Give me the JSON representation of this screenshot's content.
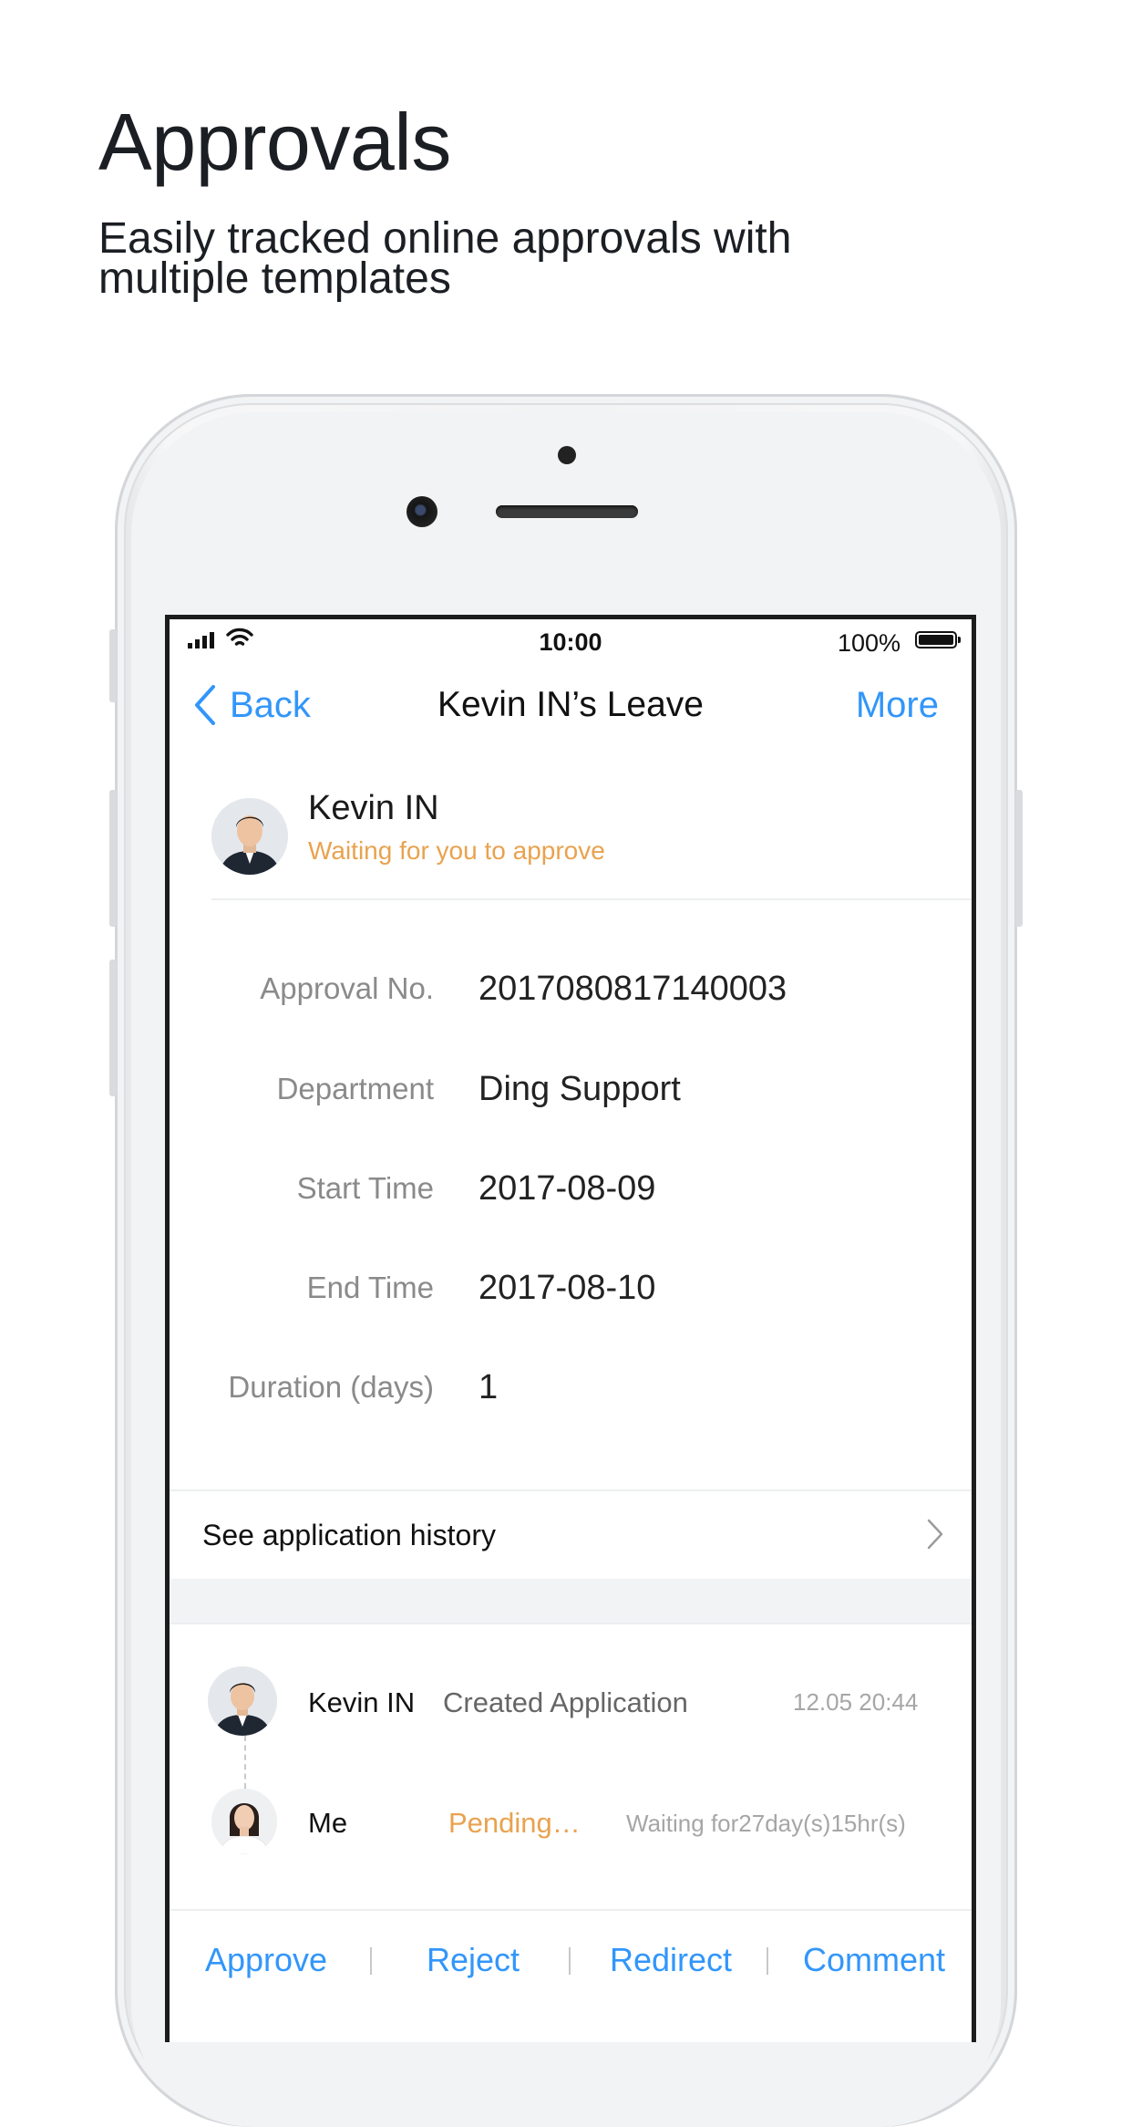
{
  "marketing": {
    "headline": "Approvals",
    "subline": "Easily tracked online approvals with multiple templates"
  },
  "status_bar": {
    "time": "10:00",
    "battery": "100%"
  },
  "nav": {
    "back_label": "Back",
    "title": "Kevin IN’s Leave",
    "more_label": "More"
  },
  "applicant": {
    "name": "Kevin IN",
    "status": "Waiting for you to approve"
  },
  "details": [
    {
      "label": "Approval No.",
      "value": "2017080817140003"
    },
    {
      "label": "Department",
      "value": "Ding Support"
    },
    {
      "label": "Start Time",
      "value": "2017-08-09"
    },
    {
      "label": "End Time",
      "value": "2017-08-10"
    },
    {
      "label": "Duration (days)",
      "value": "1"
    }
  ],
  "history_link": "See application history",
  "flow": [
    {
      "name": "Kevin IN",
      "action": "Created Application",
      "time": "12.05 20:44"
    },
    {
      "name": "Me",
      "action": "Pending…",
      "time": "Waiting for27day(s)15hr(s)"
    }
  ],
  "actions": {
    "approve": "Approve",
    "reject": "Reject",
    "redirect": "Redirect",
    "comment": "Comment"
  },
  "colors": {
    "accent": "#3296fa",
    "pending": "#e9a24f"
  }
}
